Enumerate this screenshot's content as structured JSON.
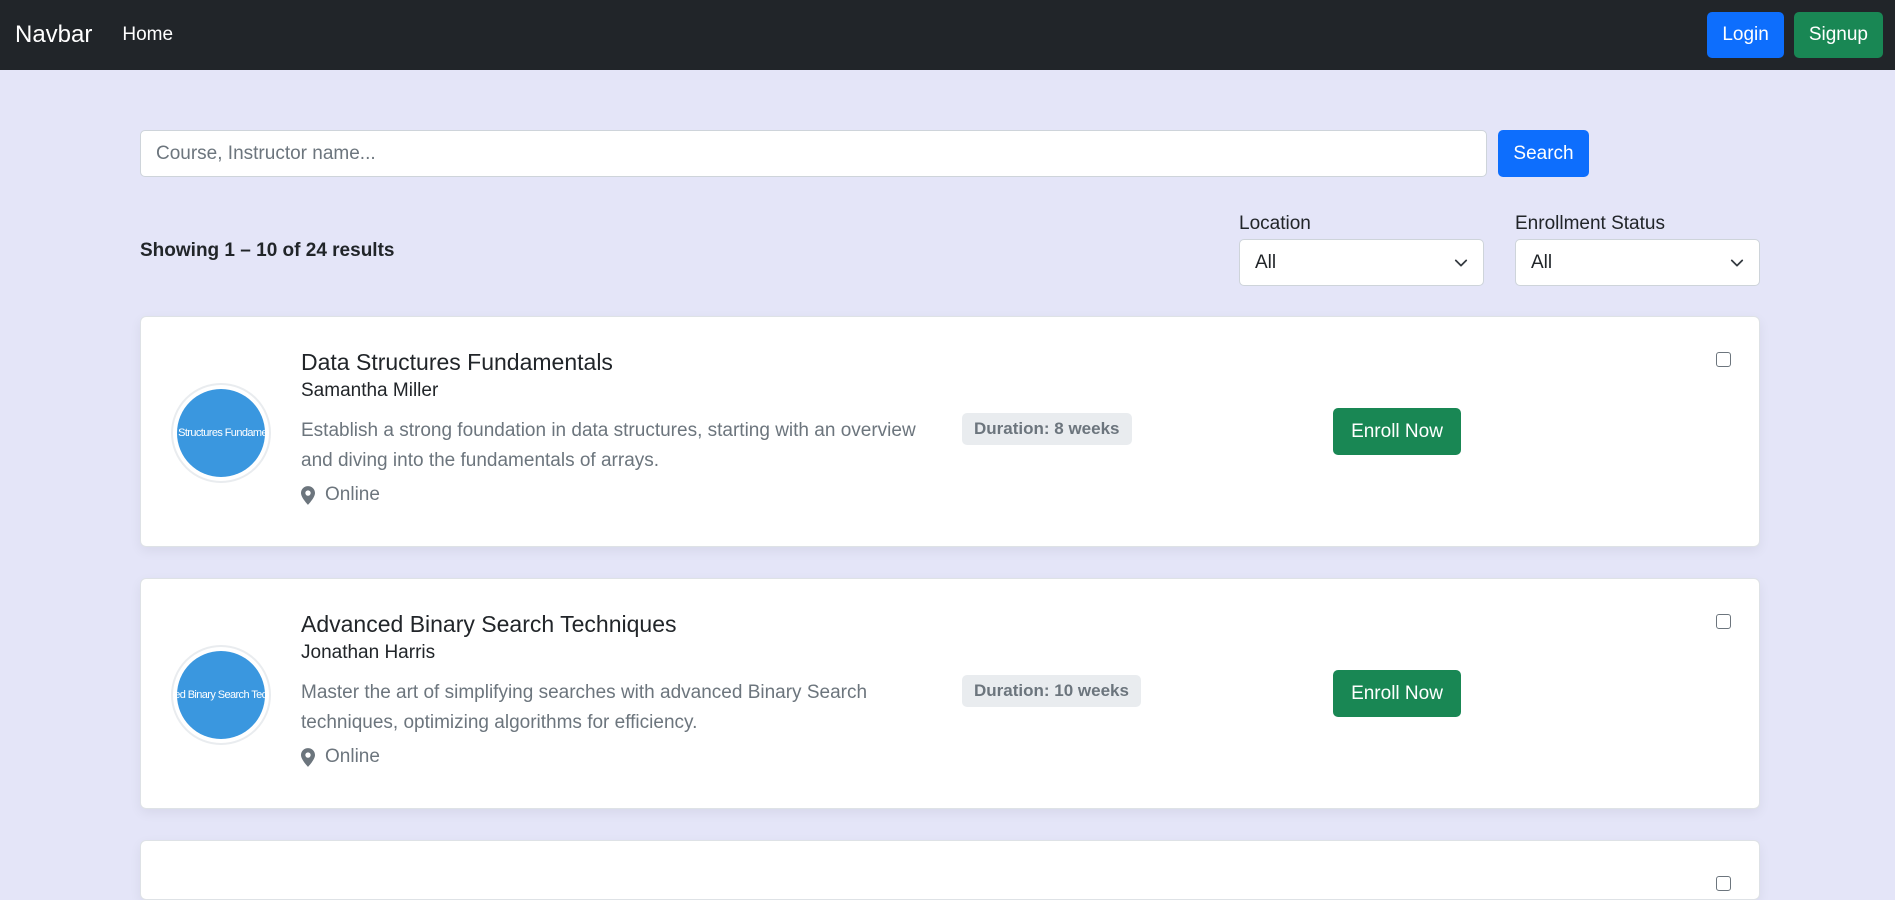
{
  "navbar": {
    "brand": "Navbar",
    "home": "Home",
    "login": "Login",
    "signup": "Signup"
  },
  "search": {
    "placeholder": "Course, Instructor name...",
    "value": "",
    "button": "Search"
  },
  "results": {
    "summary": "Showing 1 – 10 of 24 results"
  },
  "filters": {
    "location": {
      "label": "Location",
      "selected": "All"
    },
    "enrollment": {
      "label": "Enrollment Status",
      "selected": "All"
    }
  },
  "courses": [
    {
      "title": "Data Structures Fundamentals",
      "instructor": "Samantha Miller",
      "description": "Establish a strong foundation in data structures, starting with an overview and diving into the fundamentals of arrays.",
      "location": "Online",
      "duration": "Duration: 8 weeks",
      "enroll": "Enroll Now",
      "avatar_text": "Data Structures Fundamentals"
    },
    {
      "title": "Advanced Binary Search Techniques",
      "instructor": "Jonathan Harris",
      "description": "Master the art of simplifying searches with advanced Binary Search techniques, optimizing algorithms for efficiency.",
      "location": "Online",
      "duration": "Duration: 10 weeks",
      "enroll": "Enroll Now",
      "avatar_text": "Advanced Binary Search Techniques"
    }
  ],
  "colors": {
    "navbar_bg": "#212529",
    "page_bg": "#e4e5f8",
    "primary": "#0d6efd",
    "success": "#198754",
    "avatar": "#3a97df"
  }
}
